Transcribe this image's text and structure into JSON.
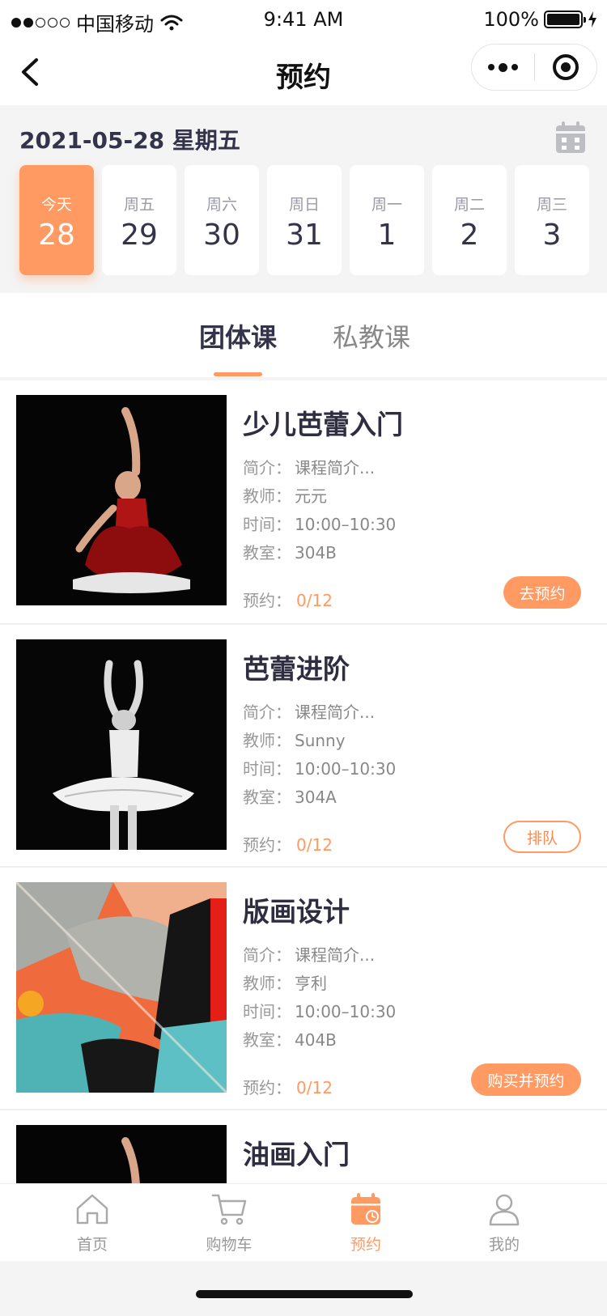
{
  "status_bar": {
    "carrier": "中国移动",
    "time": "9:41 AM",
    "battery": "100%"
  },
  "nav": {
    "title": "预约"
  },
  "date_header": {
    "text": "2021-05-28 星期五"
  },
  "days": [
    {
      "weekday": "今天",
      "date": "28",
      "active": true
    },
    {
      "weekday": "周五",
      "date": "29"
    },
    {
      "weekday": "周六",
      "date": "30"
    },
    {
      "weekday": "周日",
      "date": "31"
    },
    {
      "weekday": "周一",
      "date": "1"
    },
    {
      "weekday": "周二",
      "date": "2"
    },
    {
      "weekday": "周三",
      "date": "3"
    }
  ],
  "tabs": [
    {
      "label": "团体课",
      "active": true
    },
    {
      "label": "私教课"
    }
  ],
  "labels": {
    "intro": "简介：",
    "teacher": "教师：",
    "time": "时间：",
    "room": "教室：",
    "booking": "预约："
  },
  "courses": [
    {
      "title": "少儿芭蕾入门",
      "intro": "课程简介...",
      "teacher": "元元",
      "time": "10:00–10:30",
      "room": "304B",
      "booked": "0/12",
      "action": "去预约",
      "action_style": "solid"
    },
    {
      "title": "芭蕾进阶",
      "intro": "课程简介...",
      "teacher": "Sunny",
      "time": "10:00–10:30",
      "room": "304A",
      "booked": "0/12",
      "action": "排队",
      "action_style": "outline"
    },
    {
      "title": "版画设计",
      "intro": "课程简介...",
      "teacher": "亨利",
      "time": "10:00–10:30",
      "room": "404B",
      "booked": "0/12",
      "action": "购买并预约",
      "action_style": "solid"
    },
    {
      "title": "油画入门"
    }
  ],
  "tab_bar": [
    {
      "label": "首页",
      "icon": "home-icon"
    },
    {
      "label": "购物车",
      "icon": "cart-icon"
    },
    {
      "label": "预约",
      "icon": "calendar-icon",
      "active": true
    },
    {
      "label": "我的",
      "icon": "user-icon"
    }
  ],
  "colors": {
    "accent": "#ff9a62",
    "text": "#33334a",
    "muted": "#999999"
  }
}
